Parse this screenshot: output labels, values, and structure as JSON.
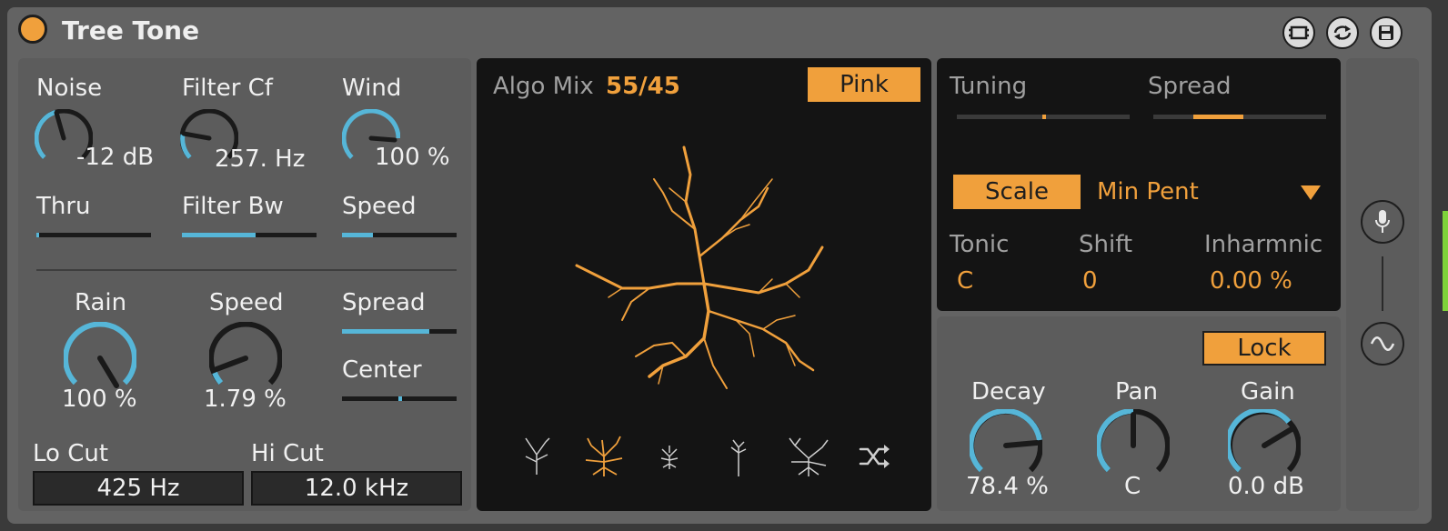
{
  "device": {
    "title": "Tree Tone",
    "accent_color": "#f0a03c",
    "knob_color": "#56b6d8"
  },
  "title_icons": [
    "map-icon",
    "refresh-icon",
    "save-icon"
  ],
  "left_panel": {
    "noise": {
      "label": "Noise",
      "value": "-12 dB",
      "level": 0.45
    },
    "filter_cf": {
      "label": "Filter Cf",
      "value": "257. Hz",
      "level": 0.18
    },
    "wind": {
      "label": "Wind",
      "value": "100 %",
      "level": 1.0
    },
    "thru": {
      "label": "Thru",
      "level": 0.02
    },
    "filter_bw": {
      "label": "Filter Bw",
      "level": 0.55
    },
    "speed_top": {
      "label": "Speed",
      "level": 0.27
    },
    "rain": {
      "label": "Rain",
      "value": "100 %",
      "level": 1.0
    },
    "speed": {
      "label": "Speed",
      "value": "1.79 %",
      "level": 0.05
    },
    "spread": {
      "label": "Spread",
      "level": 0.76
    },
    "center": {
      "label": "Center",
      "level": 0.5
    },
    "lo_cut": {
      "label": "Lo Cut",
      "value": "425 Hz"
    },
    "hi_cut": {
      "label": "Hi Cut",
      "value": "12.0 kHz"
    }
  },
  "center_panel": {
    "algo_mix_label": "Algo Mix",
    "algo_mix_value": "55/45",
    "noise_type_button": "Pink",
    "tree_icons": [
      "tree-sparse-icon",
      "tree-bushy-icon",
      "tree-dense-icon",
      "tree-thin-icon",
      "tree-spread-icon",
      "shuffle-icon"
    ],
    "selected_tree": 1
  },
  "tuning_panel": {
    "tuning": {
      "label": "Tuning",
      "level": 0.5
    },
    "spread": {
      "label": "Spread",
      "level_start": 0.23,
      "level_end": 0.52
    },
    "scale_button": "Scale",
    "scale_value": "Min Pent",
    "tonic": {
      "label": "Tonic",
      "value": "C"
    },
    "shift": {
      "label": "Shift",
      "value": "0"
    },
    "inharmonic": {
      "label": "Inharmnic",
      "value": "0.00 %"
    }
  },
  "output_panel": {
    "lock_button": "Lock",
    "decay": {
      "label": "Decay",
      "value": "78.4 %",
      "level": 0.78
    },
    "pan": {
      "label": "Pan",
      "value": "C",
      "level": 0.5
    },
    "gain": {
      "label": "Gain",
      "value": "0.0 dB",
      "level": 0.73
    }
  },
  "side_strip": {
    "icons": [
      "microphone-icon",
      "sine-wave-icon"
    ]
  }
}
